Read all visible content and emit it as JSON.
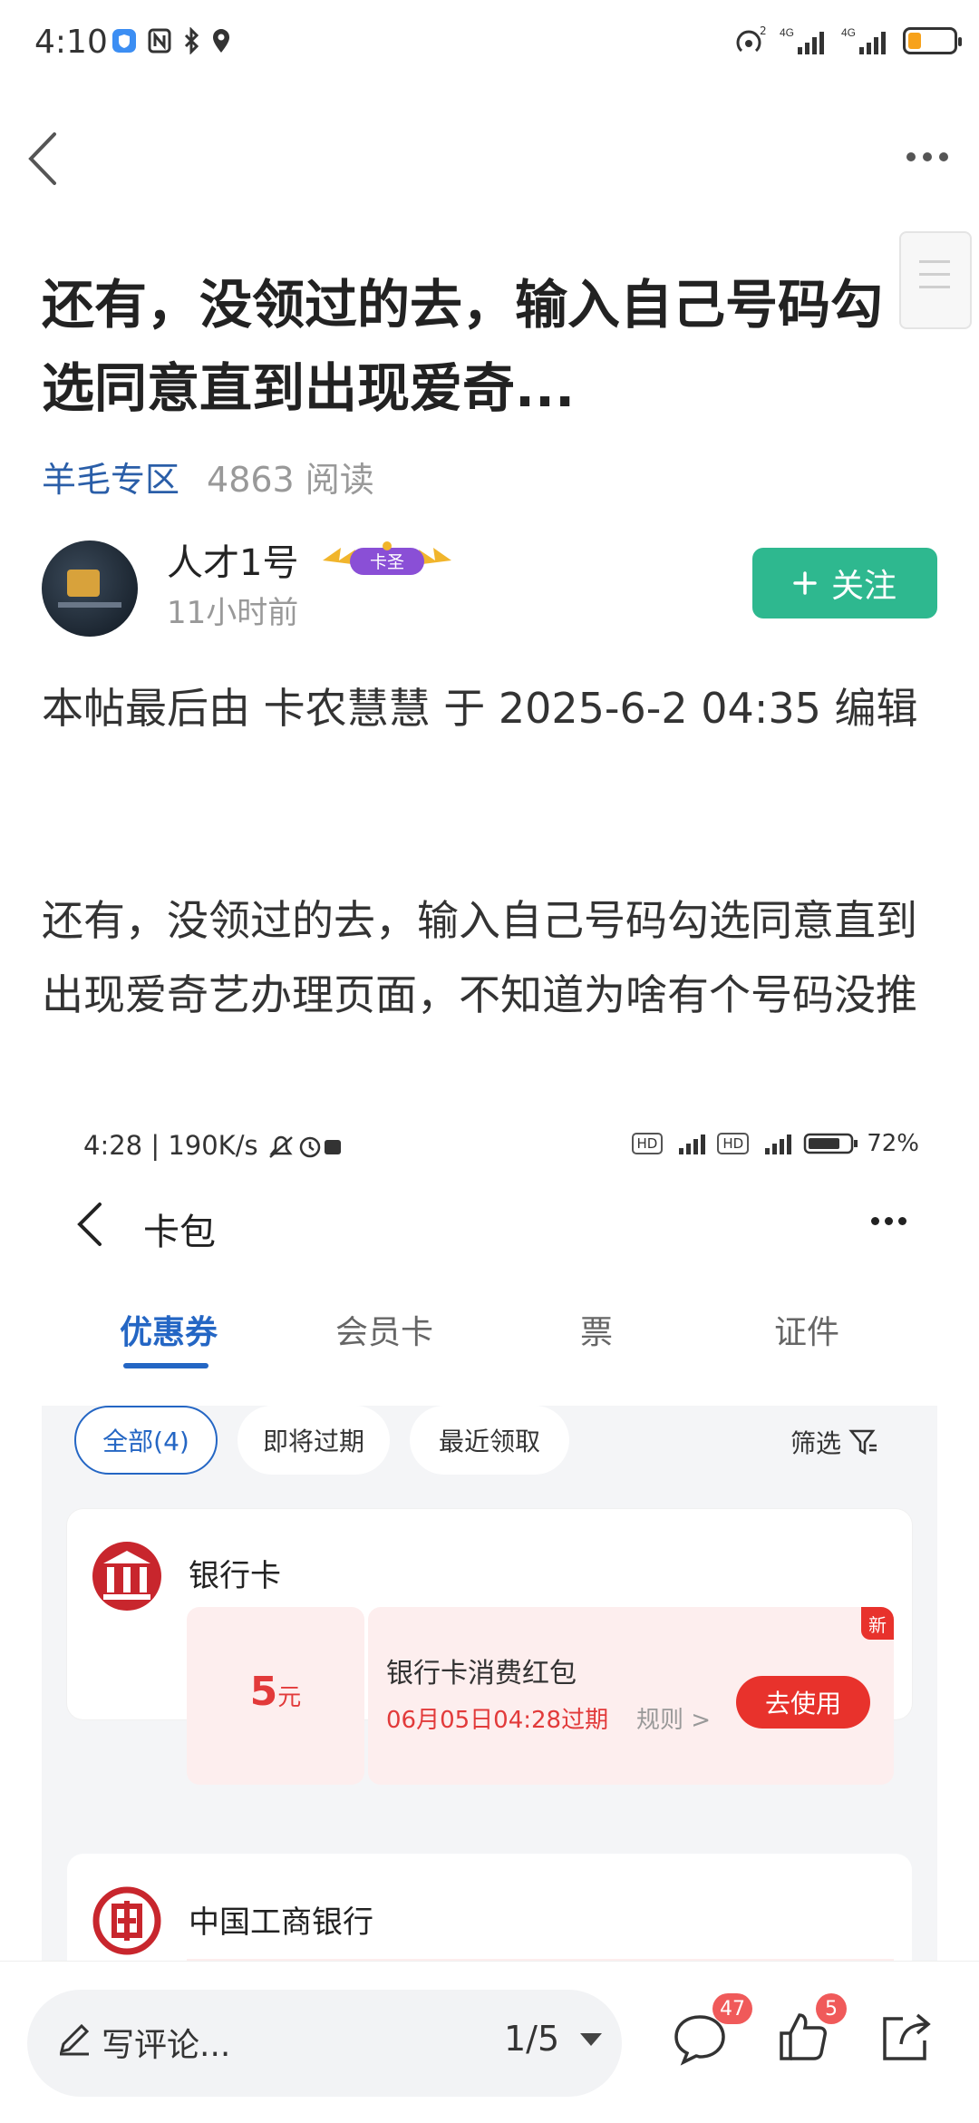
{
  "status_bar": {
    "time": "4:10"
  },
  "header": {},
  "post": {
    "title": "还有，没领过的去，输入自己号码勾选同意直到出现爱奇...",
    "category": "羊毛专区",
    "reads": "4863 阅读",
    "author": "人才1号",
    "badge": "卡圣",
    "time_ago": "11小时前",
    "follow_label": "关注",
    "edit_note": "本帖最后由 卡农慧慧 于 2025-6-2 04:35 编辑",
    "body": "还有，没领过的去，输入自己号码勾选同意直到出现爱奇艺办理页面，不知道为啥有个号码没推"
  },
  "screenshot": {
    "status_time": "4:28 | 190K/s",
    "status_right": "72%",
    "title": "卡包",
    "tabs": [
      "优惠券",
      "会员卡",
      "票",
      "证件"
    ],
    "chips": [
      "全部(4)",
      "即将过期",
      "最近领取"
    ],
    "filter_label": "筛选",
    "bank_name": "银行卡",
    "coupon": {
      "amount": "5",
      "unit": "元",
      "title": "银行卡消费红包",
      "expiry": "06月05日04:28过期",
      "rule": "规则 >",
      "use_label": "去使用",
      "new_label": "新"
    },
    "second_bank": "中国工商银行"
  },
  "bottom_bar": {
    "comment_placeholder": "写评论...",
    "page": "1/5",
    "comments_count": "47",
    "likes_count": "5"
  },
  "colors": {
    "accent_green": "#2eb88f",
    "tag_blue": "#2a5ea8",
    "tab_blue": "#2466c4",
    "red": "#e8322c"
  }
}
